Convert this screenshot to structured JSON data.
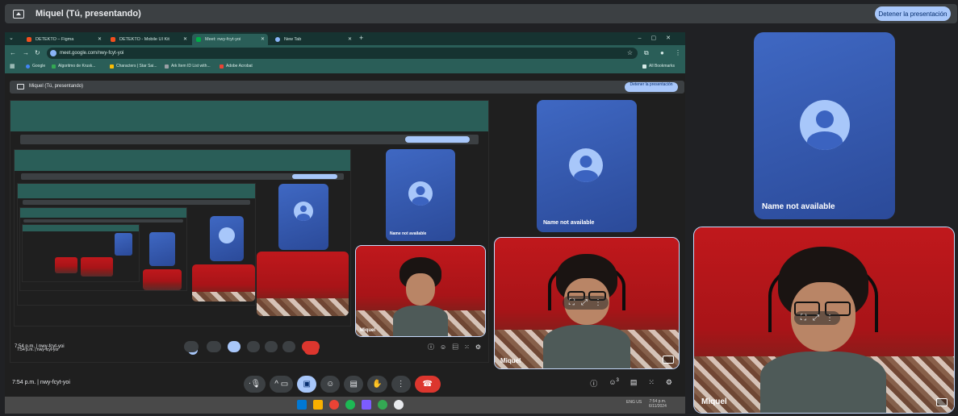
{
  "banner": {
    "title": "Miquel (Tú, presentando)",
    "stop_label": "Detener la presentación"
  },
  "browser": {
    "tabs": [
      {
        "label": "DETEKTO – Figma",
        "color": "#f24e1e"
      },
      {
        "label": "DETEKTO - Mobile UI Kit",
        "color": "#f24e1e"
      },
      {
        "label": "Meet: nwy-fcyt-yoi",
        "color": "#00ac47"
      },
      {
        "label": "New Tab",
        "color": "#8ab4f8"
      }
    ],
    "url": "meet.google.com/nwy-fcyt-yoi",
    "bookmarks": [
      {
        "label": "Google",
        "color": "#4285f4"
      },
      {
        "label": "Algoritmo de Krusk...",
        "color": "#34a853"
      },
      {
        "label": "Characters | Star Sai...",
        "color": "#fbbc04"
      },
      {
        "label": "Ark Item ID List with...",
        "color": "#9aa0a6"
      },
      {
        "label": "Adobe Acrobat",
        "color": "#ea4335"
      }
    ],
    "all_bookmarks": "All Bookmarks"
  },
  "inner": {
    "title": "Miquel (Tú, presentando)",
    "stop_label": "Detener la presentación"
  },
  "tiles": {
    "name_not_available": "Name not available",
    "participant": "Miquel"
  },
  "bottom": {
    "time": "7:54 p.m.",
    "separator": "|",
    "meeting_code": "nwy-fcyt-yoi",
    "people_count": "3"
  },
  "taskbar": {
    "clock": "7:54 p.m.",
    "date": "6/11/2024",
    "lang": "ENG US",
    "colors": [
      "#0078d4",
      "#f9b000",
      "#1db954",
      "#ea4335",
      "#7c5cff",
      "#34a853",
      "#e8eaed"
    ]
  }
}
